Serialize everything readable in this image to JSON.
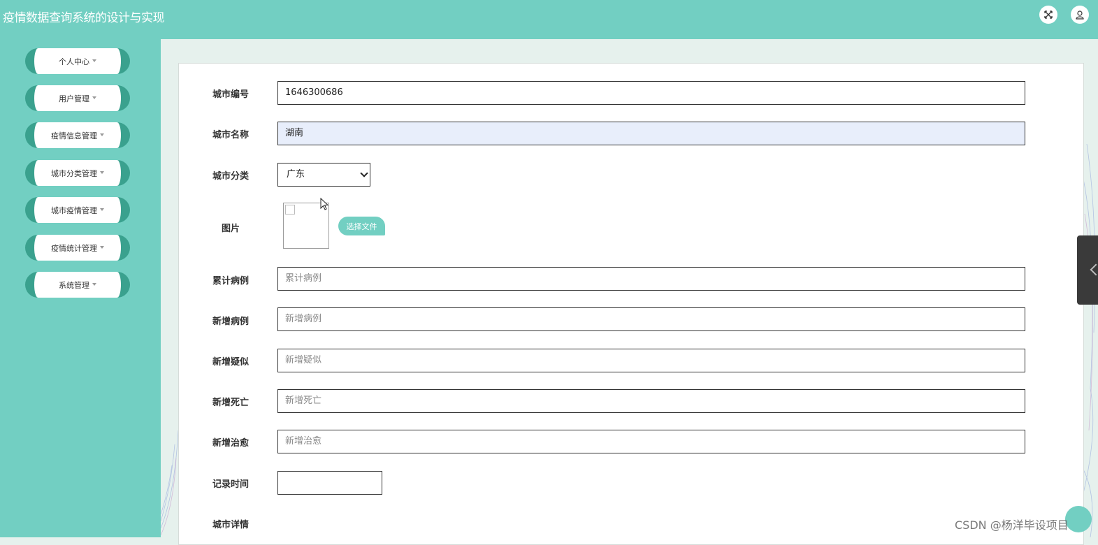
{
  "app": {
    "title": "疫情数据查询系统的设计与实现"
  },
  "header": {
    "icons": [
      "fullscreen-icon",
      "user-icon"
    ]
  },
  "sidebar": {
    "items": [
      {
        "label": "个人中心"
      },
      {
        "label": "用户管理"
      },
      {
        "label": "疫情信息管理"
      },
      {
        "label": "城市分类管理"
      },
      {
        "label": "城市疫情管理"
      },
      {
        "label": "疫情统计管理"
      },
      {
        "label": "系统管理"
      }
    ]
  },
  "form": {
    "city_no": {
      "label": "城市编号",
      "value": "1646300686"
    },
    "city_name": {
      "label": "城市名称",
      "value": "湖南"
    },
    "city_category": {
      "label": "城市分类",
      "selected": "广东"
    },
    "image": {
      "label": "图片",
      "button": "选择文件"
    },
    "total_cases": {
      "label": "累计病例",
      "placeholder": "累计病例"
    },
    "new_cases": {
      "label": "新增病例",
      "placeholder": "新增病例"
    },
    "new_suspected": {
      "label": "新增疑似",
      "placeholder": "新增疑似"
    },
    "new_deaths": {
      "label": "新增死亡",
      "placeholder": "新增死亡"
    },
    "new_recovered": {
      "label": "新增治愈",
      "placeholder": "新增治愈"
    },
    "record_time": {
      "label": "记录时间",
      "value": ""
    },
    "city_detail": {
      "label": "城市详情"
    }
  },
  "watermark": "CSDN @杨洋毕设项目",
  "colors": {
    "primary": "#72cfc2",
    "accent": "#3aa18e",
    "background": "#e6f1ed"
  }
}
